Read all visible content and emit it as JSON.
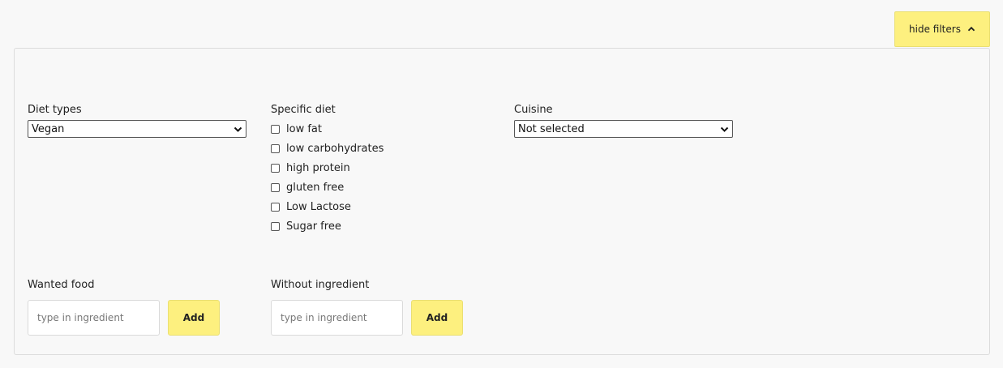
{
  "header": {
    "hide_filters_label": "hide filters"
  },
  "diet_types": {
    "label": "Diet types",
    "selected": "Vegan"
  },
  "specific_diet": {
    "label": "Specific diet",
    "options": [
      {
        "label": "low fat",
        "checked": false
      },
      {
        "label": "low carbohydrates",
        "checked": false
      },
      {
        "label": "high protein",
        "checked": false
      },
      {
        "label": "gluten free",
        "checked": false
      },
      {
        "label": "Low Lactose",
        "checked": false
      },
      {
        "label": "Sugar free",
        "checked": false
      }
    ]
  },
  "cuisine": {
    "label": "Cuisine",
    "selected": "Not selected"
  },
  "wanted_food": {
    "label": "Wanted food",
    "placeholder": "type in ingredient",
    "add_label": "Add"
  },
  "without_ingredient": {
    "label": "Without ingredient",
    "placeholder": "type in ingredient",
    "add_label": "Add"
  },
  "colors": {
    "accent": "#fdf07f",
    "background": "#f8f8f8",
    "border": "#dcdcdc"
  },
  "icons": {
    "toggle": "chevron-up-icon",
    "select": "chevron-down-icon"
  }
}
